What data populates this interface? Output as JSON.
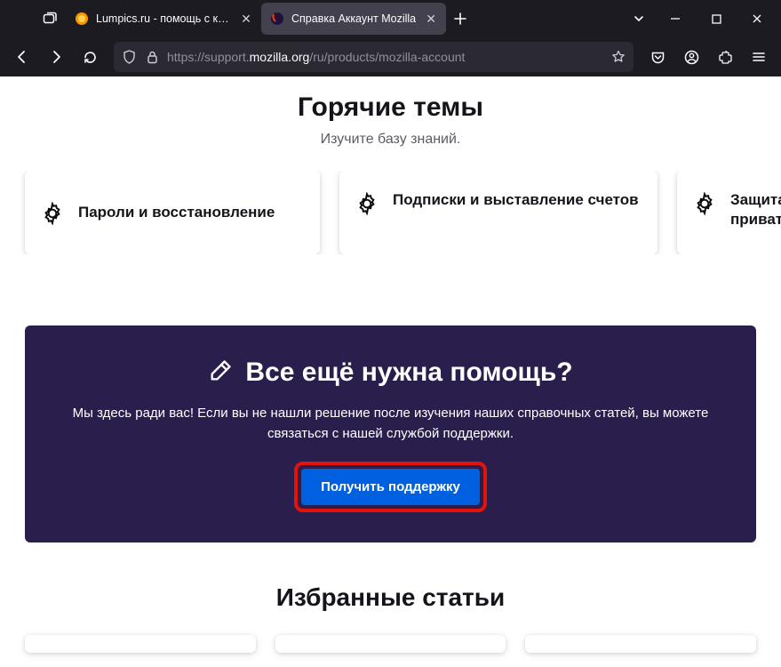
{
  "browser": {
    "tabs": [
      {
        "title": "Lumpics.ru - помощь с компь"
      },
      {
        "title": "Справка Аккаунт Mozilla"
      }
    ],
    "url": {
      "scheme": "https://",
      "sub": "support.",
      "host": "mozilla.org",
      "path": "/ru/products/mozilla-account"
    }
  },
  "page": {
    "hot_topics_title": "Горячие темы",
    "hot_topics_sub": "Изучите базу знаний.",
    "topics": [
      "Пароли и восстановление",
      "Подписки и выставление счетов",
      "Защита приват"
    ],
    "help": {
      "title": "Все ещё нужна помощь?",
      "desc": "Мы здесь ради вас! Если вы не нашли решение после изучения наших справочных статей, вы можете связаться с нашей службой поддержки.",
      "button": "Получить поддержку"
    },
    "featured_title": "Избранные статьи"
  }
}
